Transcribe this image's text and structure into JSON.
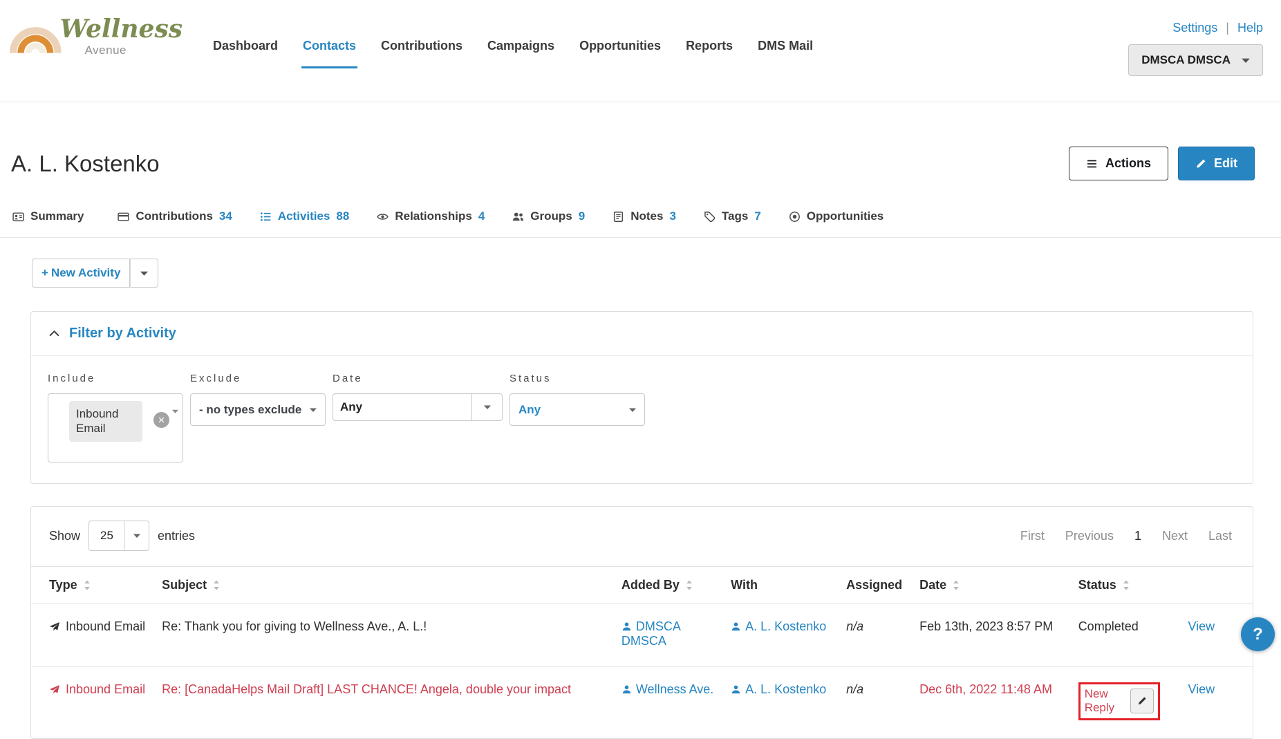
{
  "brand": {
    "script": "Wellness",
    "sub": "Avenue"
  },
  "header": {
    "nav": [
      {
        "label": "Dashboard"
      },
      {
        "label": "Contacts"
      },
      {
        "label": "Contributions"
      },
      {
        "label": "Campaigns"
      },
      {
        "label": "Opportunities"
      },
      {
        "label": "Reports"
      },
      {
        "label": "DMS Mail"
      }
    ],
    "settings": "Settings",
    "divider": "|",
    "help": "Help",
    "user": "DMSCA DMSCA"
  },
  "page": {
    "title": "A. L. Kostenko",
    "actions": "Actions",
    "edit": "Edit"
  },
  "tabs": [
    {
      "label": "Summary",
      "count": ""
    },
    {
      "label": "Contributions",
      "count": "34"
    },
    {
      "label": "Activities",
      "count": "88"
    },
    {
      "label": "Relationships",
      "count": "4"
    },
    {
      "label": "Groups",
      "count": "9"
    },
    {
      "label": "Notes",
      "count": "3"
    },
    {
      "label": "Tags",
      "count": "7"
    },
    {
      "label": "Opportunities",
      "count": ""
    }
  ],
  "toolbar": {
    "plus": "+",
    "new_activity": "New Activity"
  },
  "filter": {
    "title": "Filter by Activity",
    "include": {
      "label": "Include",
      "tag": "Inbound Email"
    },
    "exclude": {
      "label": "Exclude",
      "value": "- no types exclude"
    },
    "date": {
      "label": "Date",
      "value": "Any"
    },
    "status": {
      "label": "Status",
      "value": "Any"
    }
  },
  "table": {
    "show": "Show",
    "page_size": "25",
    "entries": "entries",
    "pagination": {
      "first": "First",
      "previous": "Previous",
      "page": "1",
      "next": "Next",
      "last": "Last"
    },
    "columns": [
      {
        "label": "Type"
      },
      {
        "label": "Subject"
      },
      {
        "label": "Added By"
      },
      {
        "label": "With"
      },
      {
        "label": "Assigned"
      },
      {
        "label": "Date"
      },
      {
        "label": "Status"
      },
      {
        "label": ""
      }
    ],
    "rows": [
      {
        "type": "Inbound Email",
        "subject": "Re: Thank you for giving to Wellness Ave., A. L.!",
        "added_by": "DMSCA DMSCA",
        "with": "A. L. Kostenko",
        "assigned": "n/a",
        "date": "Feb 13th, 2023 8:57 PM",
        "status": "Completed",
        "view": "View"
      },
      {
        "type": "Inbound Email",
        "subject": "Re: [CanadaHelps Mail Draft] LAST CHANCE! Angela, double your impact",
        "added_by": "Wellness Ave.",
        "with": "A. L. Kostenko",
        "assigned": "n/a",
        "date": "Dec 6th, 2022 11:48 AM",
        "status": "New Reply",
        "view": "View"
      }
    ]
  },
  "help_fab": "?",
  "colors": {
    "accent": "#2786C2",
    "danger": "#CE3E50",
    "annotation": "#E42127",
    "brand_green": "#7C8C52",
    "brand_orange": "#DE8F35"
  }
}
